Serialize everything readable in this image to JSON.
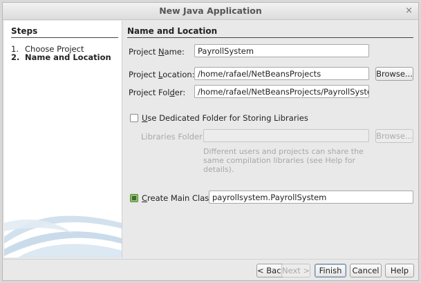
{
  "window": {
    "title": "New Java Application",
    "close_glyph": "×"
  },
  "steps": {
    "heading": "Steps",
    "items": [
      {
        "num": "1.",
        "label": "Choose Project"
      },
      {
        "num": "2.",
        "label": "Name and Location"
      }
    ]
  },
  "panel": {
    "heading": "Name and Location",
    "project_name": {
      "label_pre": "Project ",
      "label_mn": "N",
      "label_post": "ame:",
      "value": "PayrollSystem"
    },
    "project_location": {
      "label_pre": "Project ",
      "label_mn": "L",
      "label_post": "ocation:",
      "value": "/home/rafael/NetBeansProjects",
      "browse": "Browse..."
    },
    "project_folder": {
      "label_pre": "Project Fol",
      "label_mn": "d",
      "label_post": "er:",
      "value": "/home/rafael/NetBeansProjects/PayrollSystem"
    },
    "dedicated_folder": {
      "label_mn": "U",
      "label_post": "se Dedicated Folder for Storing Libraries",
      "checked": false
    },
    "libraries_folder": {
      "label": "Libraries Folder:",
      "value": "",
      "browse": "Browse..."
    },
    "libraries_help": "Different users and projects can share the\nsame compilation libraries (see Help for\ndetails).",
    "main_class": {
      "label_mn": "C",
      "label_post": "reate Main Class",
      "value": "payrollsystem.PayrollSystem",
      "checked": true
    }
  },
  "footer": {
    "back": "< Back",
    "next": "Next >",
    "finish": "Finish",
    "cancel": "Cancel",
    "help": "Help"
  },
  "icons": {
    "window-close": "close-icon",
    "wave": "netbeans-wave-graphic"
  }
}
